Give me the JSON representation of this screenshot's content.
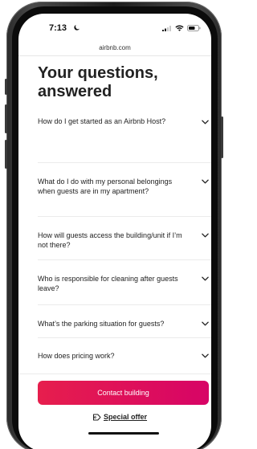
{
  "status_bar": {
    "time": "7:13",
    "moon_icon": "moon-icon",
    "signal_icon": "cellular-signal-icon",
    "wifi_icon": "wifi-icon",
    "battery_icon": "battery-icon"
  },
  "browser": {
    "url": "airbnb.com"
  },
  "page": {
    "title": "Your questions, answered"
  },
  "faq": {
    "items": [
      {
        "question": "How do I get started as an Airbnb Host?"
      },
      {
        "question": "What do I do with my personal belongings when guests are in my apartment?"
      },
      {
        "question": "How will guests access the building/unit if I’m not there?"
      },
      {
        "question": "Who is responsible for cleaning after guests leave?"
      },
      {
        "question": "What’s the parking situation for guests?"
      },
      {
        "question": "How does pricing work?"
      }
    ],
    "chevron_icon": "chevron-down-icon"
  },
  "footer": {
    "contact_label": "Contact building",
    "offer_label": "Special offer",
    "offer_icon": "tag-icon"
  },
  "colors": {
    "accent_start": "#e61e4d",
    "accent_end": "#d70466",
    "text": "#222222"
  }
}
